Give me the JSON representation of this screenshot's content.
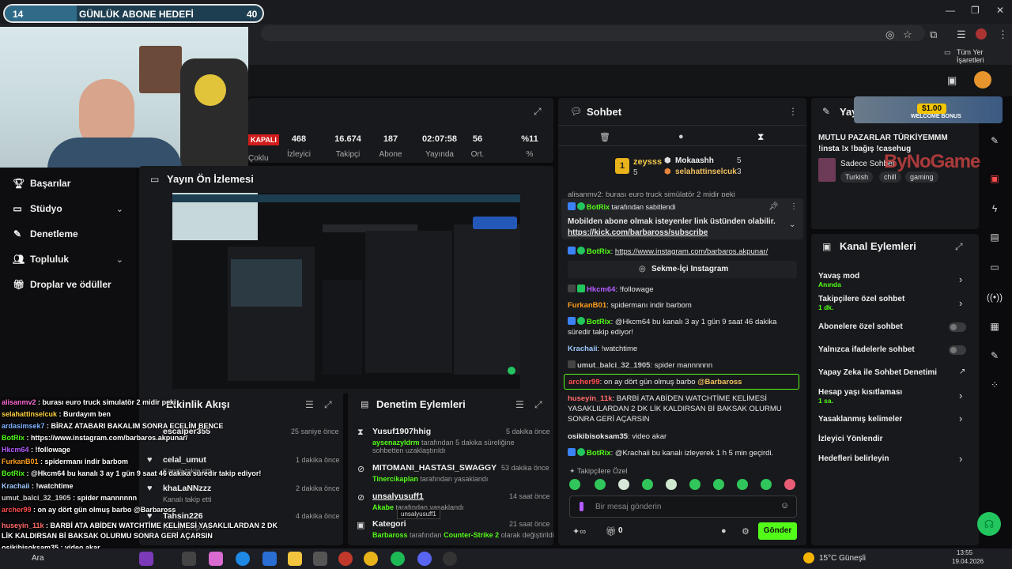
{
  "goal_bar": {
    "left": "14",
    "title": "GÜNLÜK ABONE HEDEFİ",
    "right": "40"
  },
  "browser": {
    "bookmarks_label": "Tüm Yer İşaretleri"
  },
  "sidebar": {
    "items": [
      {
        "label": "Başarılar",
        "icon": "trophy-icon"
      },
      {
        "label": "Stüdyo",
        "icon": "studio-icon"
      },
      {
        "label": "Denetleme",
        "icon": "wrench-icon"
      },
      {
        "label": "Topluluk",
        "icon": "people-icon"
      },
      {
        "label": "Droplar ve ödüller",
        "icon": "gift-icon"
      }
    ]
  },
  "stats": {
    "status": "KAPALI",
    "status_sub": "Çoklu",
    "items": [
      {
        "value": "468",
        "label": "İzleyici"
      },
      {
        "value": "16.674",
        "label": "Takipçi"
      },
      {
        "value": "187",
        "label": "Abone"
      },
      {
        "value": "02:07:58",
        "label": "Yayında"
      },
      {
        "value": "56",
        "label": "Ort."
      },
      {
        "value": "%11",
        "label": "%"
      }
    ]
  },
  "preview": {
    "title": "Yayın Ön İzlemesi"
  },
  "activity": {
    "title": "Etkinlik Akışı",
    "rows": [
      {
        "name": "escalper355",
        "sub": "",
        "time": "25 saniye önce"
      },
      {
        "name": "celal_umut",
        "sub": "Kanalı takip etti",
        "time": "1 dakika önce"
      },
      {
        "name": "khaLaNNzzz",
        "sub": "Kanalı takip etti",
        "time": "2 dakika önce"
      },
      {
        "name": "Tahsin226",
        "sub": "Kanalı takip etti",
        "time": "4 dakika önce"
      }
    ]
  },
  "moderation": {
    "title": "Denetim Eylemleri",
    "rows": [
      {
        "name": "Yusuf1907hhig",
        "actor": "aysenazyldrm",
        "text": " tarafından 5 dakika süreliğine sohbetten uzaklaştırıldı",
        "time": "5 dakika önce"
      },
      {
        "name": "MITOMANI_HASTASI_SWAGGY",
        "actor": "Tinercikaplan",
        "text": " tarafından yasaklandı",
        "time": "53 dakika önce"
      },
      {
        "name": "unsalyusuff1",
        "actor": "Akabe",
        "text": " tarafından yasaklandı",
        "time": "14 saat önce",
        "tooltip": "unsalyusuff1"
      },
      {
        "name": "Kategori",
        "actor": "Barbaross",
        "text": " tarafından ",
        "actor2": "Counter-Strike 2",
        "text2": " olarak değiştirildi",
        "time": "21 saat önce"
      }
    ]
  },
  "chat": {
    "title": "Sohbet",
    "top": [
      {
        "rank": "1",
        "name": "zeysss",
        "count": "5"
      },
      {
        "name": "Mokaashh",
        "count": "5"
      },
      {
        "name": "selahattinselcuk",
        "count": "3"
      }
    ],
    "cut_line": "alisanmv2: burası euro truck simülatör 2 midir peki",
    "pinned": {
      "by": "BotRix",
      "by_suffix": " tarafından sabitlendi",
      "text": "Mobilden abone olmak isteyenler link üstünden olabilir.",
      "link": "https://kick.com/barbaross/subscribe"
    },
    "messages": [
      {
        "user": "BotRix",
        "color": "#53fc18",
        "text": ": ",
        "link": "https://www.instagram.com/barbaros.akpunar/"
      },
      {
        "user": "",
        "color": "",
        "text": "",
        "button": "Sekme-İçi Instagram"
      },
      {
        "user": "Hkcm64",
        "color": "#b45cff",
        "text": ": !followage"
      },
      {
        "user": "FurkanB01",
        "color": "#ff9f1c",
        "text": ": spidermanı indir barbom"
      },
      {
        "user": "BotRix",
        "color": "#53fc18",
        "text": ": @Hkcm64 bu kanalı 3 ay 1 gün 9 saat 46 dakika süredir takip ediyor!"
      },
      {
        "user": "Krachaii",
        "color": "#9ec9ff",
        "text": ": !watchtime"
      },
      {
        "user": "umut_balci_32_1905",
        "color": "#c7c7c7",
        "text": ": spider mannnnnn"
      },
      {
        "user": "archer99",
        "color": "#ff4d4d",
        "text": ": on ay dört gün olmuş barbo ",
        "mention": "@Barbaross"
      },
      {
        "user": "huseyin_11k",
        "color": "#ff6b6b",
        "text": ": BARBİ ATA ABİDEN WATCHTİME KELİMESİ YASAKLILARDAN 2 DK LİK KALDIRSAN Bİ BAKSAK OLURMU SONRA GERİ AÇARSIN"
      },
      {
        "user": "osikibisoksam35",
        "color": "#f0f0f0",
        "text": ": video akar"
      },
      {
        "user": "BotRix",
        "color": "#53fc18",
        "text": ": @Krachaii bu kanalı izleyerek 1 h 5 min geçirdi."
      }
    ],
    "emote_label": "Takipçilere Özel",
    "input_placeholder": "Bir mesaj gönderin",
    "points": "0",
    "send_label": "Gönder"
  },
  "stream_info": {
    "title": "Yayın B",
    "text": "MUTLU PAZARLAR TÜRKİYEMMM !insta !x !bağış !casehug",
    "subtitle": "Sadece Sohbet",
    "tags": [
      "Turkish",
      "chill",
      "gaming"
    ],
    "promo": "$1.00",
    "promo_sub": "WELCOME BONUS",
    "watermark": "ByNoGame"
  },
  "channel_actions": {
    "title": "Kanal Eylemleri",
    "items": [
      {
        "label": "Yavaş mod",
        "sub": "Anında",
        "control": "chevron"
      },
      {
        "label": "Takipçilere özel sohbet",
        "sub": "1 dk.",
        "control": "chevron"
      },
      {
        "label": "Abonelere özel sohbet",
        "sub": "",
        "control": "toggle"
      },
      {
        "label": "Yalnızca ifadelerle sohbet",
        "sub": "",
        "control": "toggle"
      },
      {
        "label": "Yapay Zeka ile Sohbet Denetimi",
        "sub": "",
        "control": "external"
      },
      {
        "label": "Hesap yaşı kısıtlaması",
        "sub": "1 sa.",
        "control": "chevron"
      },
      {
        "label": "Yasaklanmış kelimeler",
        "sub": "",
        "control": "chevron"
      },
      {
        "label": "İzleyici Yönlendir",
        "sub": "",
        "control": "none"
      },
      {
        "label": "Hedefleri belirleyin",
        "sub": "",
        "control": "chevron"
      }
    ]
  },
  "overlay_chat": [
    {
      "user": "alisanmv2",
      "color": "#ff6bd6",
      "text": " : burası euro truck simulatör 2 midir peki"
    },
    {
      "user": "selahattinselcuk",
      "color": "#ffd23f",
      "text": " : Burdayım ben"
    },
    {
      "user": "ardasimsek7",
      "color": "#7fb2ff",
      "text": " : BİRAZ ATABARI BAKALIM SONRA ECELİM BENCE"
    },
    {
      "user": "BotRix",
      "color": "#53fc18",
      "text": " : https://www.instagram.com/barbaros.akpunar/"
    },
    {
      "user": "Hkcm64",
      "color": "#b45cff",
      "text": " : !followage"
    },
    {
      "user": "FurkanB01",
      "color": "#ff9f1c",
      "text": " : spidermanı indir barbom"
    },
    {
      "user": "BotRix",
      "color": "#53fc18",
      "text": " : @Hkcm64 bu kanalı 3 ay 1 gün 9 saat 46 dakika süredir takip ediyor!"
    },
    {
      "user": "Krachaii",
      "color": "#9ec9ff",
      "text": " : !watchtime"
    },
    {
      "user": "umut_balci_32_1905",
      "color": "#d0d0d0",
      "text": " : spider mannnnnn"
    },
    {
      "user": "archer99",
      "color": "#ff4d4d",
      "text": " : on ay dört gün olmuş barbo @Barbaross"
    },
    {
      "user": "huseyin_11k",
      "color": "#ff6b6b",
      "text": " : BARBİ ATA ABİDEN WATCHTİME KELİMESİ YASAKLILARDAN 2 DK"
    },
    {
      "user": "",
      "color": "#ffffff",
      "text": "LİK KALDIRSAN Bİ BAKSAK OLURMU SONRA GERİ AÇARSIN"
    },
    {
      "user": "osikibisoksam35",
      "color": "#ffffff",
      "text": " : video akar"
    },
    {
      "user": "BotRix",
      "color": "#53fc18",
      "text": " : @Krachaii bu kanalı izleyerek 1 h 5 min geçirdi."
    }
  ],
  "taskbar": {
    "search": "Ara",
    "weather": "15°C  Güneşli",
    "time": "13:55",
    "date": "19.04.2026"
  },
  "colors": {
    "accent": "#53fc18",
    "panel": "#18191c",
    "bg": "#0b0b0d"
  }
}
